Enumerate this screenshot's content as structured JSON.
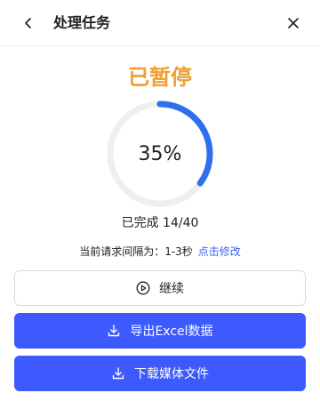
{
  "header": {
    "title": "处理任务",
    "back_icon": "chevron-left-icon",
    "close_icon": "close-icon"
  },
  "status": {
    "label": "已暂停",
    "color": "#f0a030"
  },
  "progress": {
    "percent_text": "35%",
    "value": 0.35,
    "ring_color": "#2f6fed",
    "track_color": "#efefef",
    "count_text": "已完成 14/40"
  },
  "interval": {
    "text": "当前请求间隔为：1-3秒",
    "link_label": "点击修改"
  },
  "actions": {
    "continue_label": "继续",
    "continue_icon": "play-circle-icon",
    "export_label": "导出Excel数据",
    "export_icon": "download-icon",
    "download_label": "下载媒体文件",
    "download_icon": "download-icon",
    "primary_color": "#3d5afe"
  }
}
